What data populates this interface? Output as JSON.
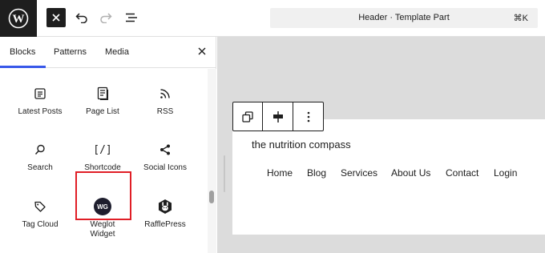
{
  "header": {
    "command_title": "Header · Template Part",
    "command_shortcut": "⌘K"
  },
  "inserter": {
    "tabs": [
      {
        "label": "Blocks",
        "active": true
      },
      {
        "label": "Patterns",
        "active": false
      },
      {
        "label": "Media",
        "active": false
      }
    ],
    "blocks": [
      {
        "label": "Latest Posts",
        "icon": "latest-posts-icon"
      },
      {
        "label": "Page List",
        "icon": "page-list-icon"
      },
      {
        "label": "RSS",
        "icon": "rss-icon"
      },
      {
        "label": "Search",
        "icon": "search-icon"
      },
      {
        "label": "Shortcode",
        "icon": "shortcode-icon",
        "icon_text": "[/]",
        "highlighted": true
      },
      {
        "label": "Social Icons",
        "icon": "share-icon"
      },
      {
        "label": "Tag Cloud",
        "icon": "tag-icon"
      },
      {
        "label": "Weglot\nWidget",
        "icon": "weglot-icon",
        "icon_text": "WG"
      },
      {
        "label": "RafflePress",
        "icon": "rafflepress-icon"
      }
    ]
  },
  "canvas": {
    "site_title": "the nutrition compass",
    "nav": [
      "Home",
      "Blog",
      "Services",
      "About Us",
      "Contact",
      "Login"
    ]
  },
  "colors": {
    "accent": "#3858e9",
    "highlight": "#e01e26",
    "dark": "#1e1e1e",
    "canvas_bg": "#dcdcdc"
  }
}
